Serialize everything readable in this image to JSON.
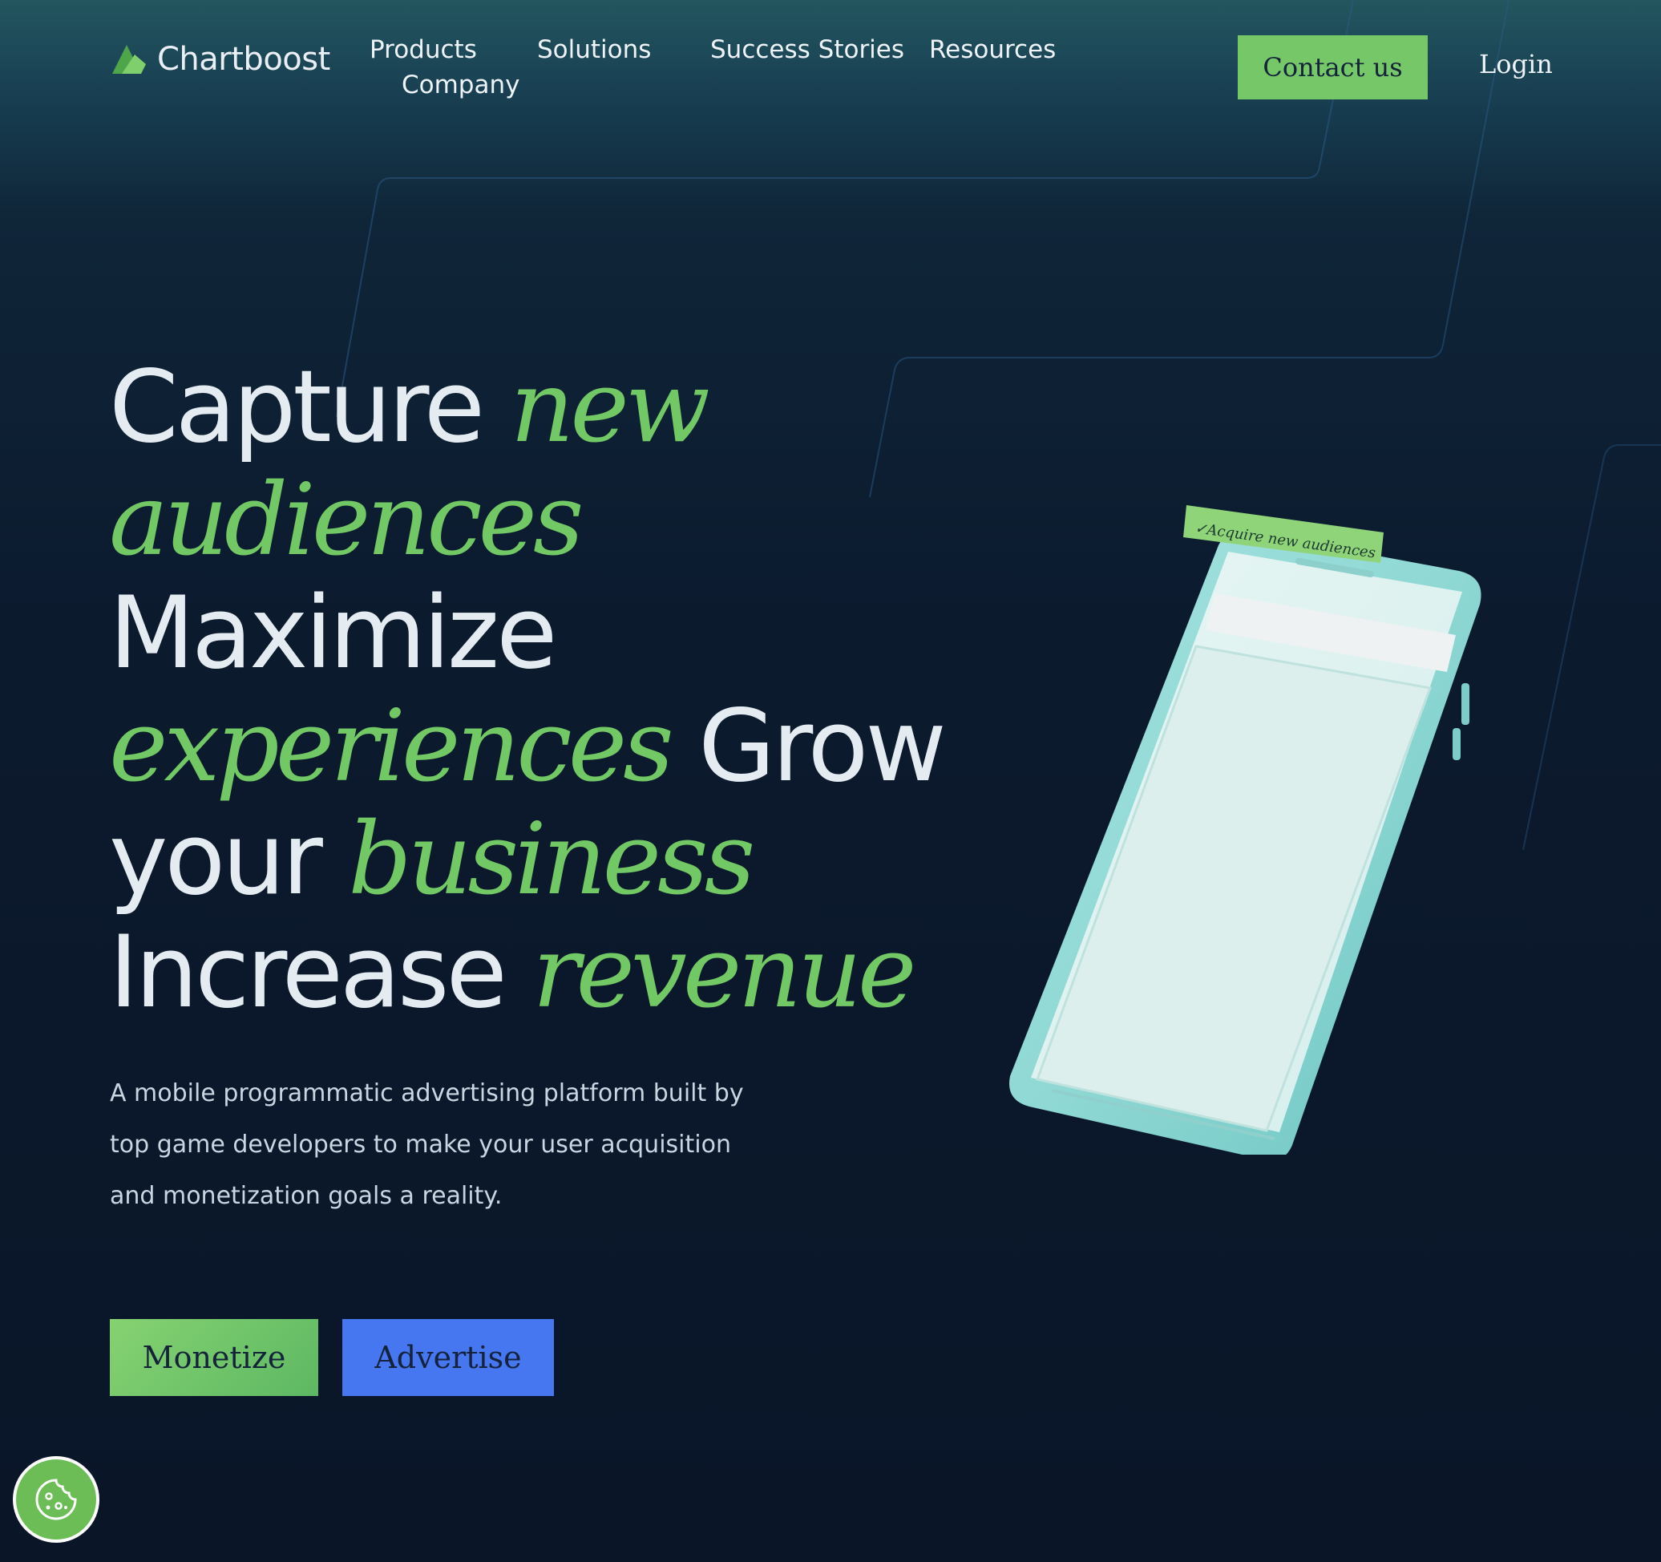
{
  "brand": {
    "name": "Chartboost",
    "accent_green": "#76c768",
    "accent_blue": "#4676f0",
    "background": "#0a1628"
  },
  "nav": {
    "products": "Products",
    "company": "Company",
    "solutions": "Solutions",
    "success_stories": "Success Stories",
    "resources": "Resources",
    "contact": "Contact us",
    "login": "Login"
  },
  "hero": {
    "word1": "Capture",
    "em1": "new audiences",
    "word2": "Maximize",
    "em2": "experiences",
    "word3": "Grow your",
    "em3": "business",
    "word4": "Increase",
    "em4": "revenue",
    "description": "A mobile programmatic advertising platform built by top game developers to make your user acquisition and monetization goals a reality.",
    "btn_monetize": "Monetize",
    "btn_advertise": "Advertise"
  },
  "phone": {
    "tag_label": "✓Acquire new audiences"
  },
  "icons": {
    "logo": "chartboost-logo-icon",
    "cookie": "cookie-icon"
  }
}
